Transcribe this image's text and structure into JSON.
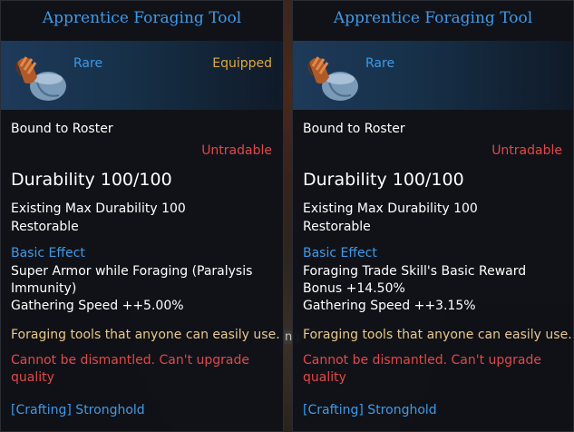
{
  "background": {
    "partial_text": "ng"
  },
  "tooltips": [
    {
      "title": "Apprentice Foraging Tool",
      "rarity": "Rare",
      "equipped": "Equipped",
      "bound": "Bound to Roster",
      "tradable": "Untradable",
      "durability": "Durability 100/100",
      "existing_max": "Existing Max Durability 100",
      "restorable": "Restorable",
      "basic_effect_label": "Basic Effect",
      "effect_line1": "Super Armor while Foraging (Paralysis Immunity)",
      "effect_line2": "Gathering Speed ++5.00%",
      "flavor": "Foraging tools that anyone can easily use.",
      "dismantle": "Cannot be dismantled.",
      "upgrade": "Can't upgrade quality",
      "crafting": "[Crafting] Stronghold"
    },
    {
      "title": "Apprentice Foraging Tool",
      "rarity": "Rare",
      "equipped": "",
      "bound": "Bound to Roster",
      "tradable": "Untradable",
      "durability": "Durability 100/100",
      "existing_max": "Existing Max Durability 100",
      "restorable": "Restorable",
      "basic_effect_label": "Basic Effect",
      "effect_line1": "Foraging Trade Skill's Basic Reward Bonus +14.50%",
      "effect_line2": "Gathering Speed ++3.15%",
      "flavor": "Foraging tools that anyone can easily use.",
      "dismantle": "Cannot be dismantled.",
      "upgrade": "Can't upgrade quality",
      "crafting": "[Crafting] Stronghold"
    }
  ],
  "colors": {
    "title": "#3d9ae8",
    "equipped": "#e0a83a",
    "untradable": "#e04848",
    "flavor": "#e8c88a"
  },
  "icons": {
    "item": "foraging-bag-glove-icon"
  }
}
